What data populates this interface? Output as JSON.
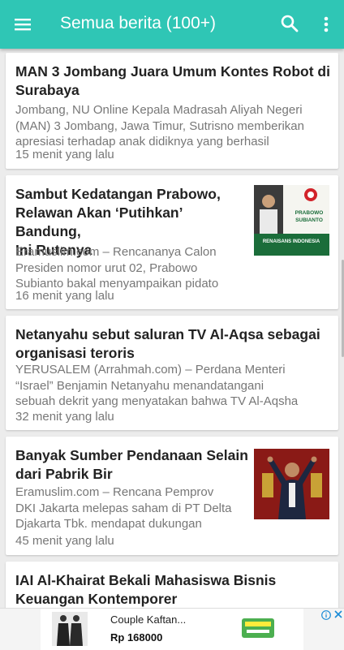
{
  "appbar": {
    "title": "Semua berita (100+)",
    "icons": [
      "menu-icon",
      "search-icon",
      "more-vert-icon"
    ],
    "color": "#2fc6b5"
  },
  "articles": [
    {
      "title_lines": [
        "MAN 3 Jombang Juara Umum Kontes Robot di",
        "Surabaya"
      ],
      "snippet_lines": [
        "Jombang, NU Online Kepala Madrasah Aliyah Negeri",
        "(MAN) 3 Jombang, Jawa Timur,  Sutrisno memberikan",
        "apresiasi terhadap anak didiknya yang berhasil"
      ],
      "time": "15 menit yang lalu",
      "has_image": false
    },
    {
      "title_lines": [
        "Sambut Kedatangan Prabowo,",
        "Relawan Akan ‘Putihkan’ Bandung,",
        "Ini Rutenya"
      ],
      "snippet_lines": [
        "Eramuslim.com –  Rencananya Calon",
        "Presiden nomor urut 02, Prabowo",
        "Subianto bakal menyampaikan pidato"
      ],
      "time": "16 menit yang lalu",
      "has_image": true,
      "image_text": {
        "line1": "PRABOWO",
        "line2": "SUBIANTO",
        "banner": "RENAISANS INDONESIA"
      }
    },
    {
      "title_lines": [
        "Netanyahu sebut saluran TV Al-Aqsa sebagai",
        "organisasi teroris"
      ],
      "snippet_lines": [
        "YERUSALEM (Arrahmah.com) – Perdana Menteri",
        "“Israel” Benjamin Netanyahu menandatangani",
        "sebuah dekrit yang menyatakan bahwa TV Al-Aqsha"
      ],
      "time": "32 menit yang lalu",
      "has_image": false
    },
    {
      "title_lines": [
        "Banyak Sumber Pendanaan Selain",
        "dari Pabrik Bir"
      ],
      "snippet_lines": [
        "Eramuslim.com – Rencana Pemprov",
        "DKI Jakarta melepas saham di PT Delta",
        "Djakarta Tbk. mendapat dukungan"
      ],
      "time": "45 menit yang lalu",
      "has_image": true
    },
    {
      "title_lines": [
        "IAI Al-Khairat Bekali Mahasiswa Bisnis",
        "Keuangan Kontemporer"
      ],
      "has_image": false
    }
  ],
  "ad": {
    "product_title": "Couple Kaftan...",
    "price": "Rp 168000",
    "info_icon": "info-icon",
    "close_icon": "close-icon"
  }
}
